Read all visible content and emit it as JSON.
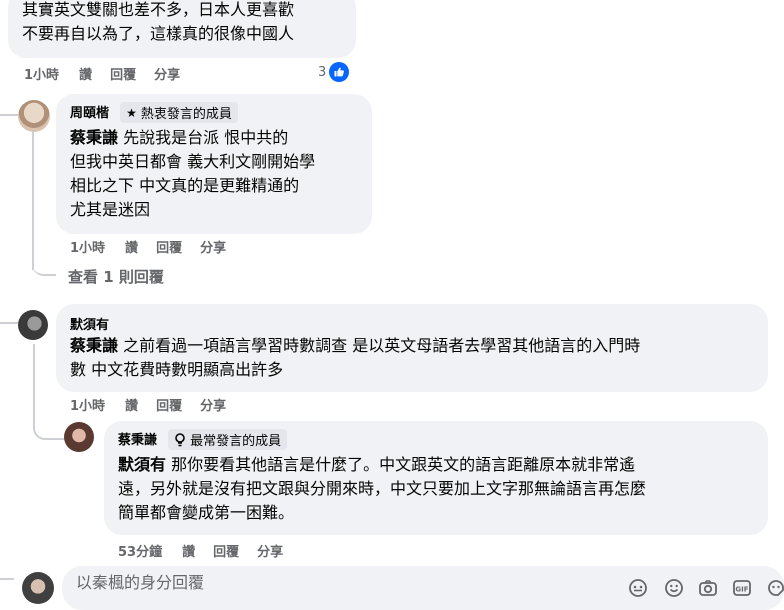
{
  "comment0": {
    "lines": [
      "其實英文雙關也差不多，日本人更喜歡",
      "不要再自以為了，這樣真的很像中國人"
    ],
    "time": "1小時",
    "like": "讚",
    "reply": "回覆",
    "share": "分享",
    "reaction_count": "3"
  },
  "comment1": {
    "author": "周頤楷",
    "badge": "熱衷發言的成員",
    "mention": "蔡秉謙",
    "lines": [
      "先說我是台派 恨中共的",
      "但我中英日都會 義大利文剛開始學",
      "相比之下 中文真的是更難精通的",
      "尤其是迷因"
    ],
    "time": "1小時",
    "like": "讚",
    "reply": "回覆",
    "share": "分享",
    "view_replies": "查看 1 則回覆"
  },
  "comment2": {
    "author": "默須有",
    "mention": "蔡秉謙",
    "line1": "之前看過一項語言學習時數調查 是以英文母語者去學習其他語言的入門時",
    "line2": "數 中文花費時數明顯高出許多",
    "time": "1小時",
    "like": "讚",
    "reply": "回覆",
    "share": "分享"
  },
  "reply1": {
    "author": "蔡秉謙",
    "badge": "最常發言的成員",
    "mention": "默須有",
    "line1": "那你要看其他語言是什麼了。中文跟英文的語言距離原本就非常遙",
    "line2": "遠，另外就是沒有把文跟與分開來時，中文只要加上文字那無論語言再怎麼",
    "line3": "簡單都會變成第一困難。",
    "time": "53分鐘",
    "like": "讚",
    "reply": "回覆",
    "share": "分享"
  },
  "composer": {
    "placeholder": "以秦楓的身分回覆"
  },
  "colors": {
    "reaction_blue": "#0866ff",
    "bubble": "#f0f2f5",
    "meta_gray": "#65676b"
  }
}
